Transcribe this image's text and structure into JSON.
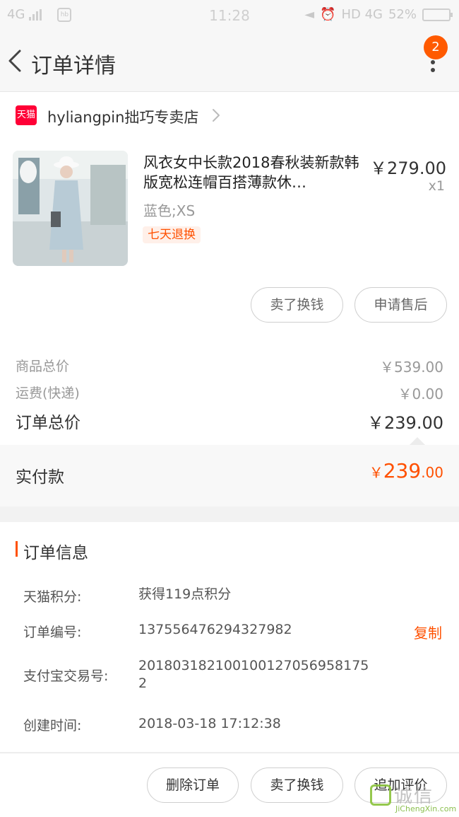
{
  "status_bar": {
    "network": "4G",
    "time": "11:28",
    "right_text": "HD 4G",
    "battery": "52%"
  },
  "nav": {
    "title": "订单详情",
    "badge_count": "2"
  },
  "shop": {
    "badge_text": "天猫",
    "name": "hyliangpin拙巧专卖店"
  },
  "product": {
    "title": "风衣女中长款2018春秋装新款韩版宽松连帽百搭薄款休…",
    "price": "￥279.00",
    "quantity": "x1",
    "spec": "蓝色;XS",
    "tag": "七天退换"
  },
  "actions": {
    "sell_label": "卖了换钱",
    "after_sale_label": "申请售后"
  },
  "summary": {
    "goods_total_label": "商品总价",
    "goods_total_value": "￥539.00",
    "shipping_label": "运费(快递)",
    "shipping_value": "￥0.00",
    "order_total_label": "订单总价",
    "order_total_value": "￥239.00",
    "paid_label": "实付款",
    "paid_currency": "￥",
    "paid_integer": "239",
    "paid_decimal": ".00"
  },
  "order_info": {
    "title": "订单信息",
    "points_label": "天猫积分:",
    "points_value": "获得119点积分",
    "order_no_label": "订单编号:",
    "order_no_value": "137556476294327982",
    "copy_label": "复制",
    "alipay_label": "支付宝交易号:",
    "alipay_value_line1": "201803182100100127056958175",
    "alipay_value_line2": "2",
    "created_label": "创建时间:",
    "created_value": "2018-03-18 17:12:38"
  },
  "bottom": {
    "delete_label": "删除订单",
    "sell_label": "卖了换钱",
    "review_label": "追加评价"
  },
  "watermark": {
    "text": "诚信",
    "sub": "JiChengXin.com"
  },
  "colors": {
    "accent": "#ff5000",
    "tmall": "#ff0036",
    "badge": "#ff5a00"
  }
}
